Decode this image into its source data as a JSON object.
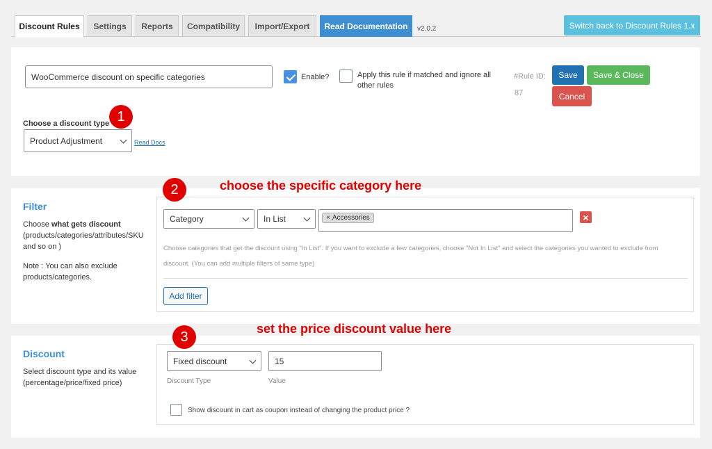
{
  "tabs": [
    {
      "label": "Discount Rules",
      "active": true
    },
    {
      "label": "Settings"
    },
    {
      "label": "Reports"
    },
    {
      "label": "Compatibility"
    },
    {
      "label": "Import/Export"
    },
    {
      "label": "Read Documentation"
    }
  ],
  "version": "v2.0.2",
  "switch_label": "Switch back to Discount Rules 1.x",
  "rule": {
    "name_value": "WooCommerce discount on specific categories",
    "enable_label": "Enable?",
    "enable_checked": true,
    "apply_label": "Apply this rule if matched and ignore all other rules",
    "apply_checked": false,
    "rule_id_label": "#Rule ID:",
    "rule_id_value": "87",
    "save_label": "Save",
    "save_close_label": "Save & Close",
    "cancel_label": "Cancel",
    "discount_type_label": "Choose a discount type",
    "discount_type_value": "Product Adjustment",
    "read_docs": "Read Docs"
  },
  "annotations": {
    "badge1": "1",
    "badge2": "2",
    "badge3": "3",
    "text2": "choose the specific category here",
    "text3": "set the price discount value here"
  },
  "filter": {
    "title": "Filter",
    "desc_prefix": "Choose ",
    "desc_bold": "what gets discount",
    "desc_rest": "(products/categories/attributes/SKU and so on )",
    "note": "Note : You can also exclude products/categories.",
    "type_value": "Category",
    "op_value": "In List",
    "tag_remove": "×",
    "tag_label": "Accessories",
    "remove_icon": "×",
    "help": "Choose categories that get the discount using \"In List\". If you want to exclude a few categories, choose \"Not In List\" and select the categories you wanted to exclude from discount. (You can add multiple filters of same type)",
    "add_filter": "Add filter"
  },
  "discount": {
    "title": "Discount",
    "desc": "Select discount type and its value (percentage/price/fixed price)",
    "type_value": "Fixed discount",
    "type_label": "Discount Type",
    "value": "15",
    "value_label": "Value",
    "coupon_label": "Show discount in cart as coupon instead of changing the product price ?"
  },
  "colors": {
    "primary": "#3d8fd1",
    "save": "#2271b1",
    "save_close": "#5cb85c",
    "cancel": "#d9534f",
    "annotation": "#e00000"
  }
}
